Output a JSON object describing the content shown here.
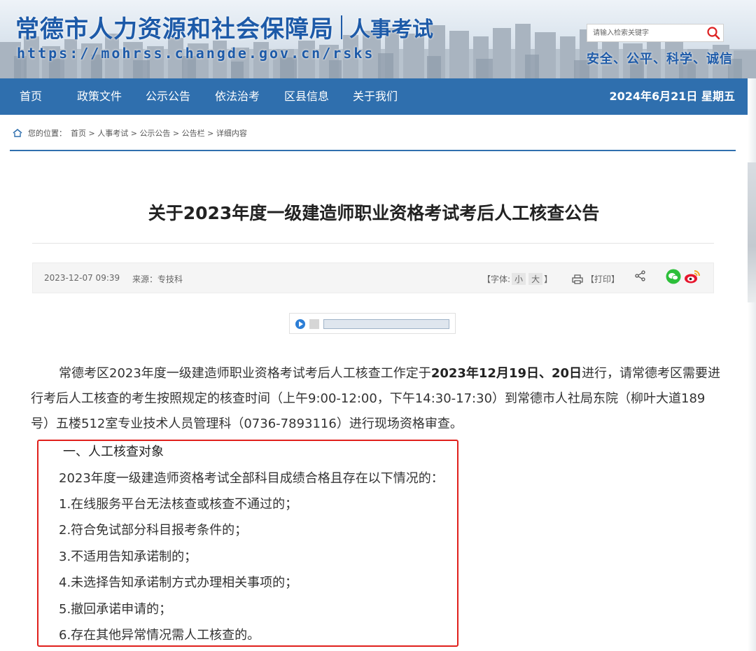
{
  "header": {
    "site_name": "常德市人力资源和社会保障局",
    "section_name": "人事考试",
    "url_text": "https://mohrss.changde.gov.cn/rsks",
    "search_placeholder": "请输入检索关键字",
    "slogan": "安全、公平、科学、诚信"
  },
  "nav": {
    "items": [
      "首页",
      "政策文件",
      "公示公告",
      "依法治考",
      "区县信息",
      "关于我们"
    ],
    "date": "2024年6月21日 星期五"
  },
  "breadcrumb": {
    "prefix": "您的位置：",
    "path": [
      "首页",
      "人事考试",
      "公示公告",
      "公告栏",
      "详细内容"
    ],
    "separator": " > "
  },
  "article": {
    "title": "关于2023年度一级建造师职业资格考试考后人工核查公告",
    "meta": {
      "date": "2023-12-07 09:39",
      "source_label": "来源：",
      "source": "专技科",
      "font_label": "【字体:",
      "font_small": "小",
      "font_large": "大",
      "font_close": "】",
      "print_label": "【打印】"
    },
    "intro": {
      "text1": "常德考区2023年度一级建造师职业资格考试考后人工核查工作定于",
      "bold": "2023年12月19日、20日",
      "text2": "进行，请常德考区需要进行考后人工核查的考生按照规定的核查时间（上午9:00-12:00，下午14:30-17:30）到常德市人社局东院（柳叶大道189号）五楼512室专业技术人员管理科（0736-7893116）进行现场资格审查。"
    },
    "section1": {
      "heading": "一、人工核查对象",
      "lead": "2023年度一级建造师资格考试全部科目成绩合格且存在以下情况的：",
      "items": [
        "1.在线服务平台无法核查或核查不通过的；",
        "2.符合免试部分科目报考条件的；",
        "3.不适用告知承诺制的；",
        "4.未选择告知承诺制方式办理相关事项的；",
        "5.撤回承诺申请的；",
        "6.存在其他异常情况需人工核查的。"
      ]
    }
  },
  "colors": {
    "brand_blue": "#1d5aa8",
    "nav_blue": "#2f6fae",
    "highlight_red": "#e0201c"
  }
}
